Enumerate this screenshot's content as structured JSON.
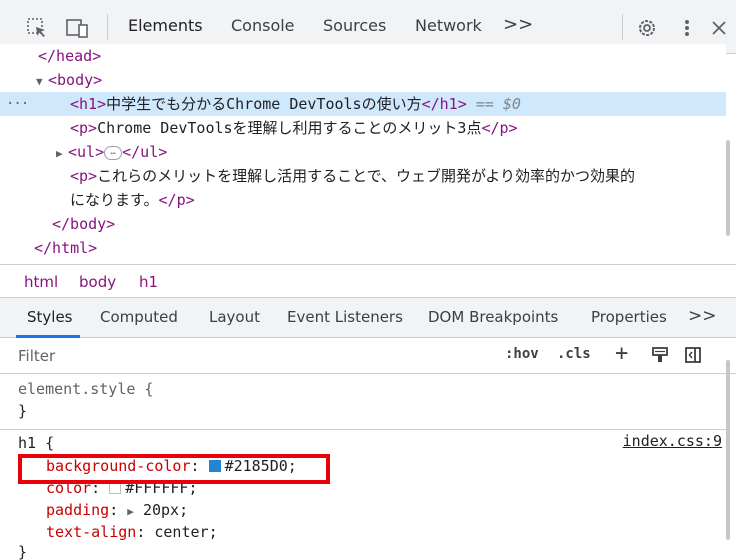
{
  "toolbar": {
    "tabs": [
      {
        "label": "Elements",
        "active": true
      },
      {
        "label": "Console"
      },
      {
        "label": "Sources"
      },
      {
        "label": "Network"
      }
    ],
    "more": ">>"
  },
  "dom": {
    "lines": [
      {
        "indent": 1,
        "open": "</head>",
        "text": "",
        "close": ""
      },
      {
        "indent": 0,
        "toggle": "▼",
        "open": "<body>",
        "text": "",
        "close": ""
      },
      {
        "indent": 2,
        "open": "<h1>",
        "text": "中学生でも分かるChrome DevToolsの使い方",
        "close": "</h1>",
        "suffix": " == $0",
        "selected": true
      },
      {
        "indent": 2,
        "open": "<p>",
        "text": "Chrome DevToolsを理解し利用することのメリット3点",
        "close": "</p>"
      },
      {
        "indent": 1,
        "toggle": "▶",
        "open": "<ul>",
        "ellipsis": "…",
        "close": "</ul>"
      },
      {
        "indent": 2,
        "open": "<p>",
        "text": "これらのメリットを理解し活用することで、ウェブ開発がより効率的かつ効果的",
        "close": ""
      },
      {
        "indent": 2,
        "open": "",
        "text": "になります。",
        "close": "</p>"
      },
      {
        "indent": 1,
        "open": "</body>",
        "text": "",
        "close": ""
      },
      {
        "indent": 0,
        "open": "</html>",
        "text": "",
        "close": ""
      }
    ],
    "dots": "···"
  },
  "breadcrumbs": [
    "html",
    "body",
    "h1"
  ],
  "styles_tabs": [
    {
      "label": "Styles",
      "active": true
    },
    {
      "label": "Computed"
    },
    {
      "label": "Layout"
    },
    {
      "label": "Event Listeners"
    },
    {
      "label": "DOM Breakpoints"
    },
    {
      "label": "Properties"
    }
  ],
  "styles_more": ">>",
  "filter": {
    "placeholder": "Filter",
    "hov": ":hov",
    "cls": ".cls",
    "plus": "+"
  },
  "rules": {
    "element_style_open": "element.style {",
    "element_style_close": "}",
    "h1_selector": "h1 {",
    "source": "index.css:9",
    "props": [
      {
        "name": "background-color",
        "value": "#2185D0",
        "swatch": "#2185D0"
      },
      {
        "name": "color",
        "value": "#FFFFFF",
        "swatch": "#FFFFFF"
      },
      {
        "name": "padding",
        "value": "20px",
        "expand": "▶"
      },
      {
        "name": "text-align",
        "value": "center"
      }
    ],
    "h1_close": "}"
  },
  "colors": {
    "accent": "#1a73e8",
    "tag": "#881280",
    "prop": "#c80000",
    "highlight": "#e8000b",
    "selected_row": "#cfe8fc"
  }
}
